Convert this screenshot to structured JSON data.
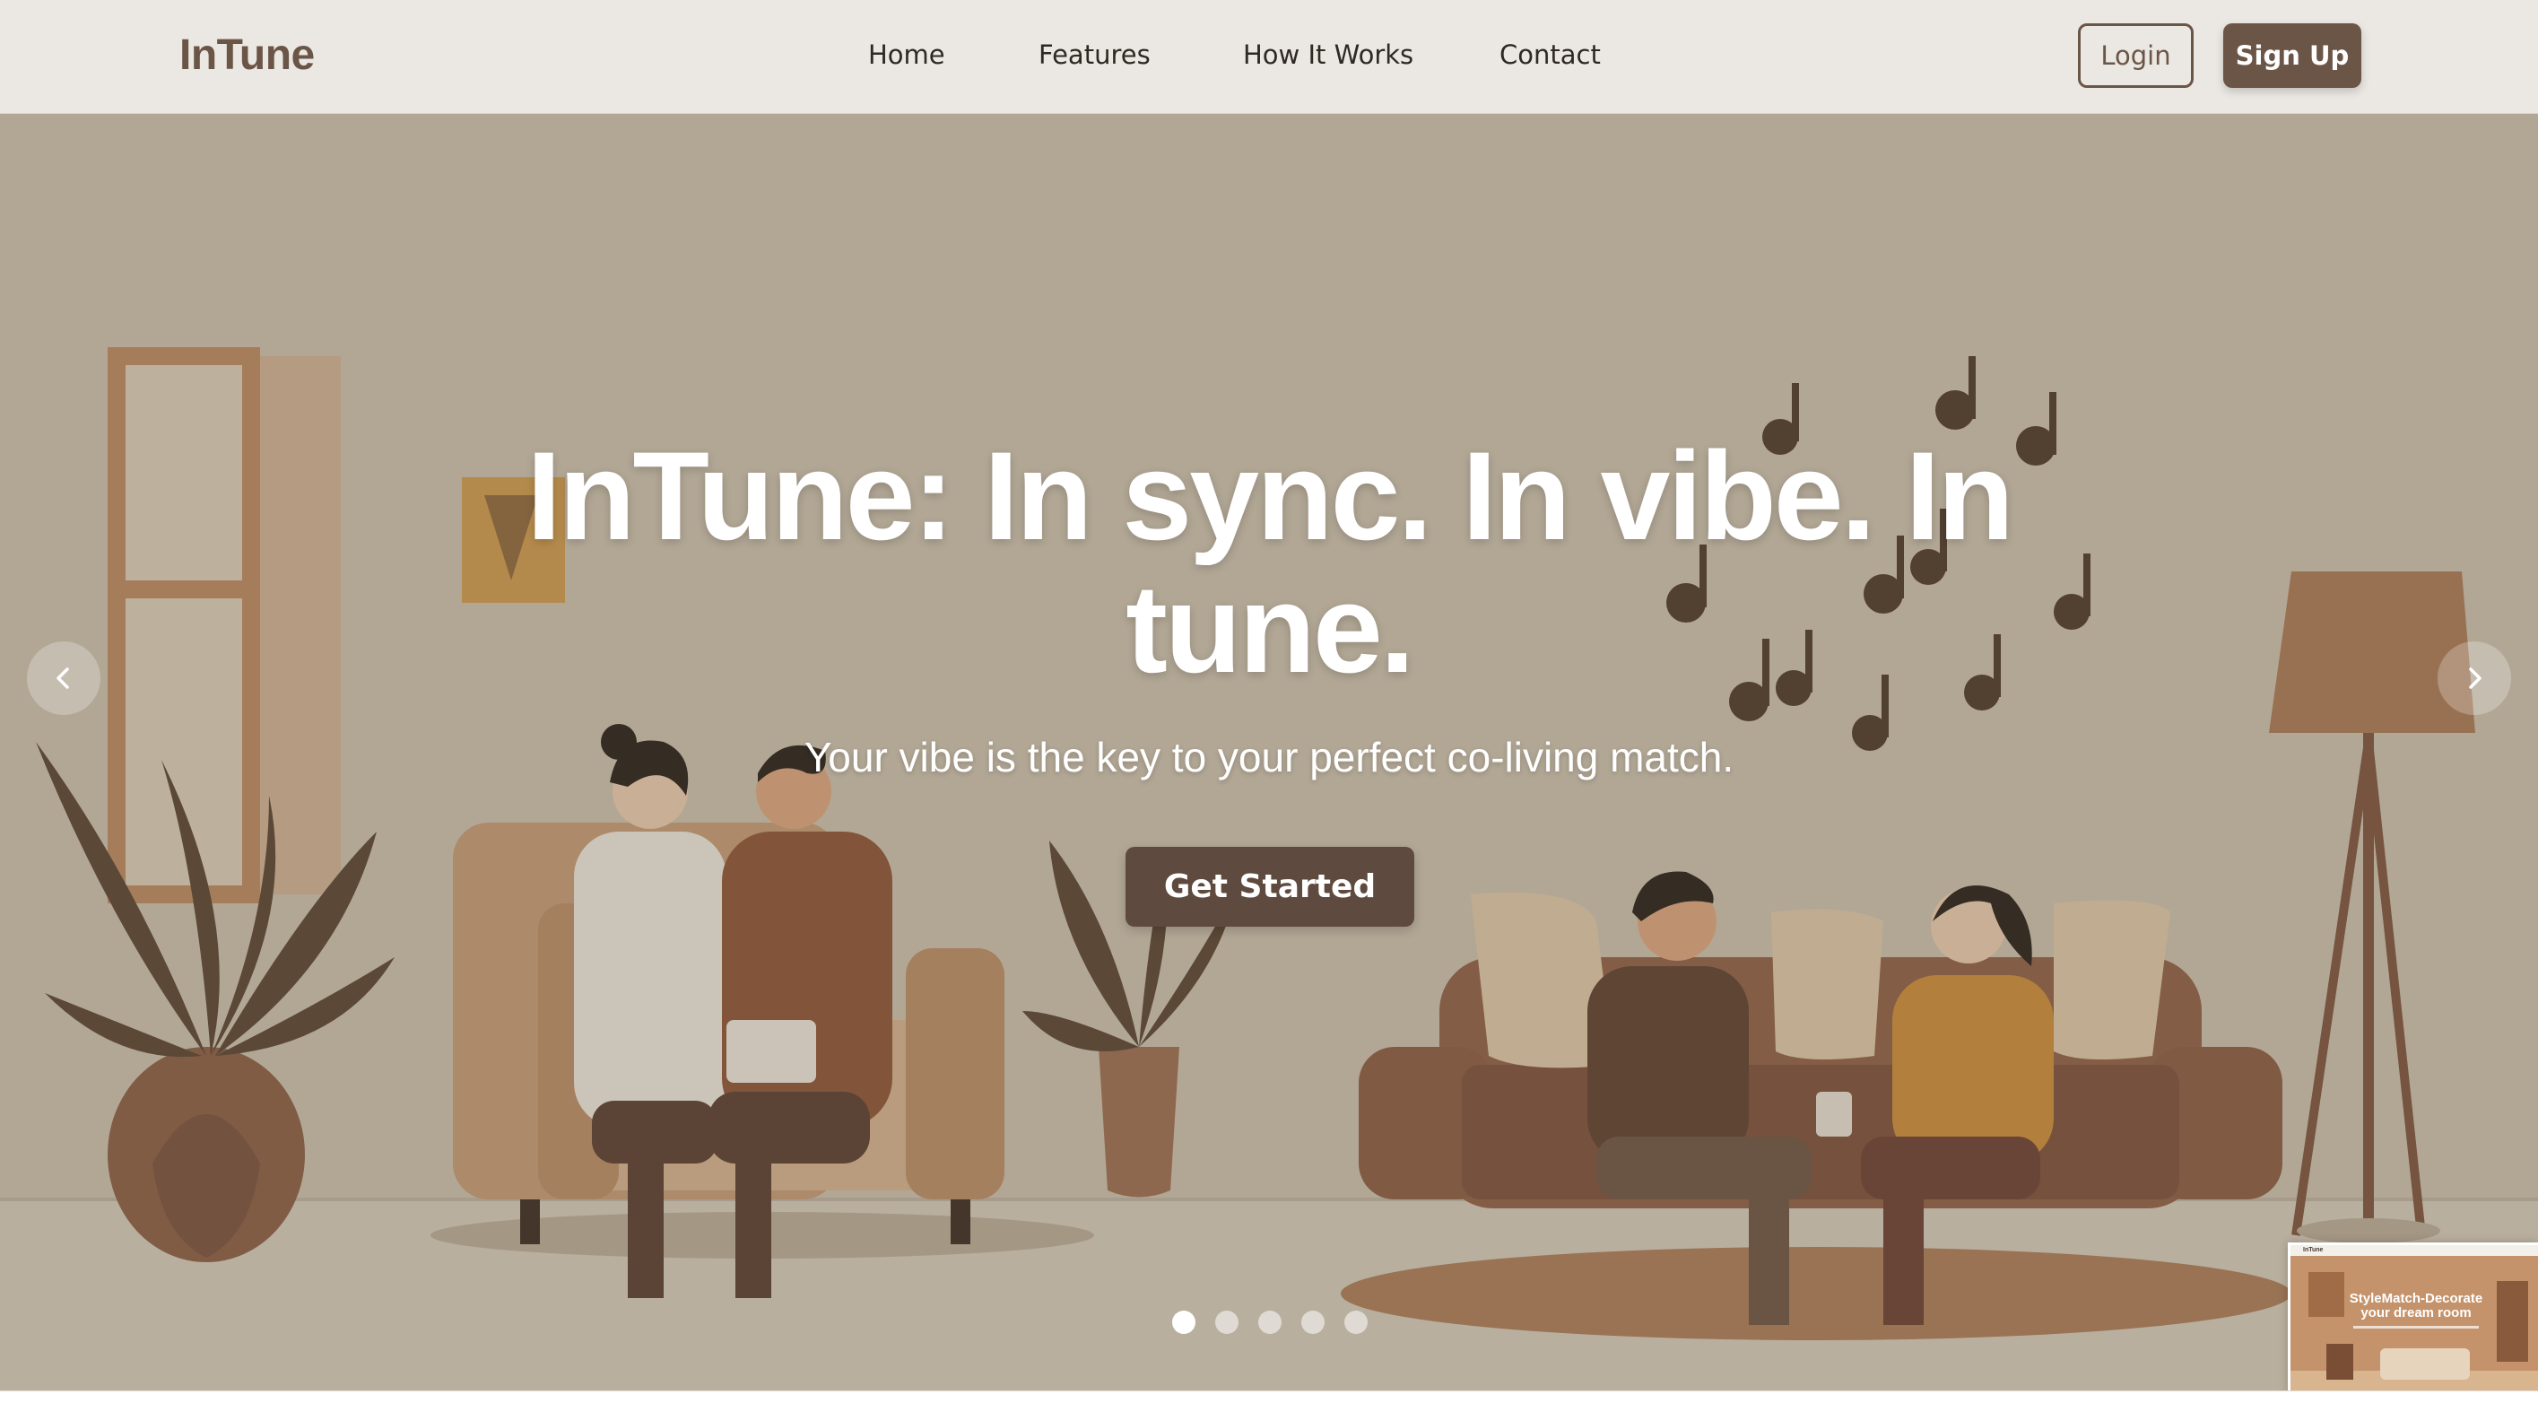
{
  "nav": {
    "logo": "InTune",
    "links": [
      {
        "label": "Home"
      },
      {
        "label": "Features"
      },
      {
        "label": "How It Works"
      },
      {
        "label": "Contact"
      }
    ],
    "login_label": "Login",
    "signup_label": "Sign Up"
  },
  "hero": {
    "title": "InTune: In sync. In vibe. In tune.",
    "subtitle": "Your vibe is the key to your perfect co-living match.",
    "cta_label": "Get Started",
    "prev_icon": "chevron-left-icon",
    "next_icon": "chevron-right-icon",
    "slides_count": 5,
    "active_slide": 1
  },
  "preview": {
    "logo": "InTune",
    "title": "StyleMatch-Decorate your dream room"
  },
  "colors": {
    "nav_background": "#ebe8e3",
    "brand_brown": "#6b5547",
    "cta_background": "#5e4a3e",
    "text_dark": "#2f2823"
  }
}
